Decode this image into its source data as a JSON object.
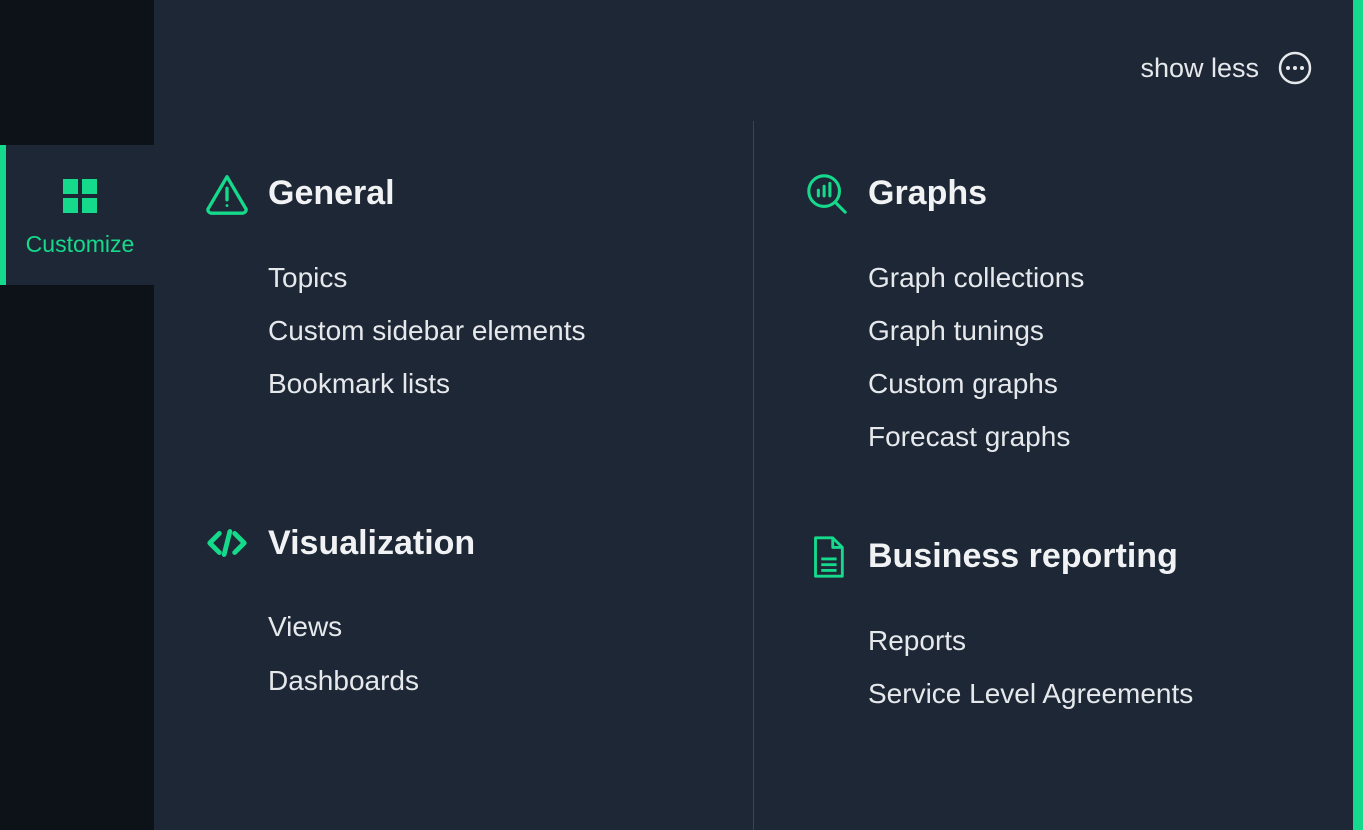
{
  "colors": {
    "accent": "#15d98b",
    "panel": "#1e2736",
    "bg_dark": "#0d1118",
    "text": "#e6e9ec"
  },
  "sidebar": {
    "active": {
      "label": "Customize",
      "icon": "apps-grid-icon"
    }
  },
  "topbar": {
    "toggle_label": "show less",
    "more_icon": "ellipsis-circle-icon"
  },
  "left_column": [
    {
      "id": "general",
      "icon": "alert-triangle-icon",
      "title": "General",
      "items": [
        "Topics",
        "Custom sidebar elements",
        "Bookmark lists"
      ]
    },
    {
      "id": "visualization",
      "icon": "code-icon",
      "title": "Visualization",
      "items": [
        "Views",
        "Dashboards"
      ]
    }
  ],
  "right_column": [
    {
      "id": "graphs",
      "icon": "graph-search-icon",
      "title": "Graphs",
      "items": [
        "Graph collections",
        "Graph tunings",
        "Custom graphs",
        "Forecast graphs"
      ]
    },
    {
      "id": "business",
      "icon": "document-icon",
      "title": "Business reporting",
      "items": [
        "Reports",
        "Service Level Agreements"
      ]
    }
  ]
}
